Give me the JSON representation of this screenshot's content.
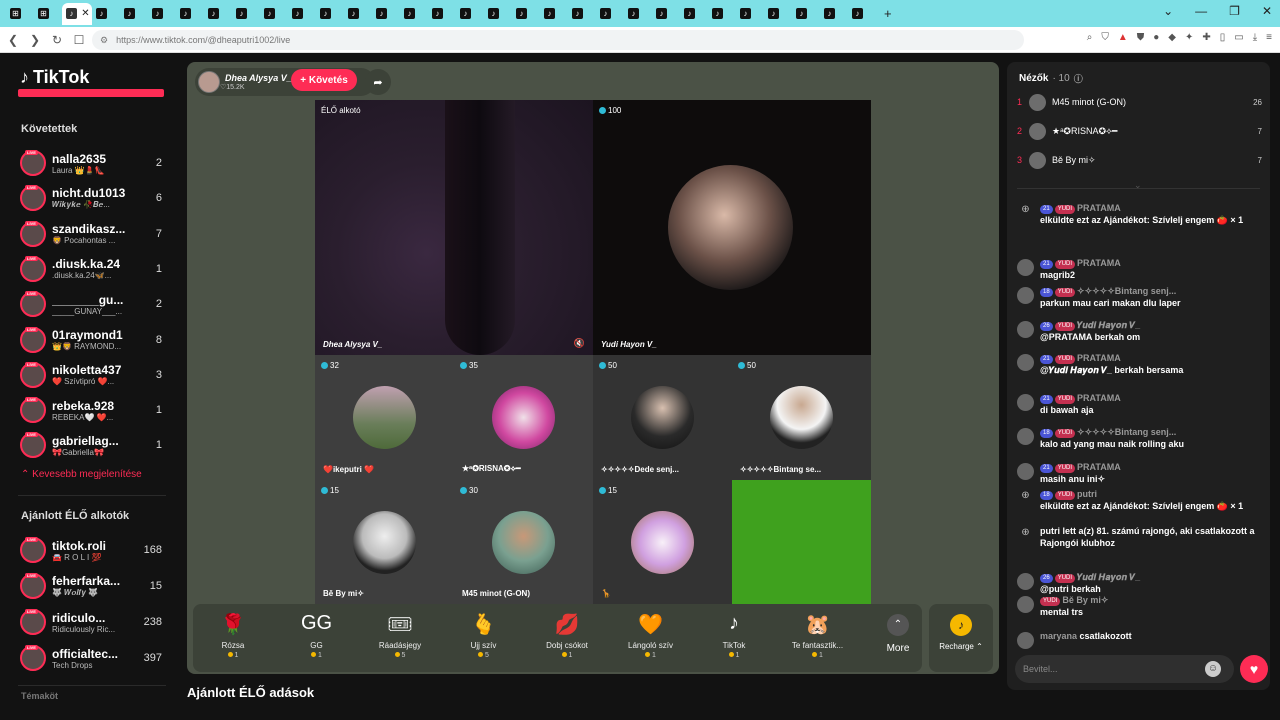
{
  "browser": {
    "tabs": [
      "",
      "",
      "",
      "",
      "",
      "",
      "",
      "",
      "",
      "",
      "",
      "",
      "",
      "",
      "",
      "",
      "",
      "",
      "",
      "",
      "",
      "",
      "",
      "",
      "",
      "",
      "",
      "",
      "",
      "",
      ""
    ],
    "active_tab_close": "✕",
    "url": "https://www.tiktok.com/@dheaputri1002/live",
    "new_tab": "+",
    "window_controls": [
      "⌄",
      "—",
      "❐",
      "✕"
    ]
  },
  "sidebar": {
    "logo": "TikTok",
    "following_title": "Követettek",
    "following": [
      {
        "name": "nalla2635",
        "sub": "Laura 👑💄👠",
        "count": "2"
      },
      {
        "name": "nicht.du1013",
        "sub": "𝑾𝒊𝒌𝒚𝒌𝒆 🥀𝑩𝒆...",
        "count": "6"
      },
      {
        "name": "szandikasz...",
        "sub": "🦁 Pocahontas ...",
        "count": "7"
      },
      {
        "name": ".diusk.ka.24",
        "sub": ".diusk.ka.24🦋...",
        "count": "1"
      },
      {
        "name": "_______gu...",
        "sub": "_____GUNAY___...",
        "count": "2"
      },
      {
        "name": "01raymond1",
        "sub": "👑🦁 RAYMOND...",
        "count": "8"
      },
      {
        "name": "nikoletta437",
        "sub": "❤️ Szívtipró ❤️...",
        "count": "3"
      },
      {
        "name": "rebeka.928",
        "sub": "REBEKA🤍 ❤️...",
        "count": "1"
      },
      {
        "name": "gabriellag...",
        "sub": "🎀Gabriella🎀",
        "count": "1"
      }
    ],
    "show_less": "Kevesebb megjelenítése",
    "recommended_title": "Ajánlott ÉLŐ alkotók",
    "recommended": [
      {
        "name": "tiktok.roli",
        "sub": "🚘 R O L I 💯",
        "count": "168"
      },
      {
        "name": "feherfarka...",
        "sub": "🐺 𝑾𝒐𝒍𝒇𝒚 🐺",
        "count": "15"
      },
      {
        "name": "ridiculo...",
        "sub": "Ridiculously Ric...",
        "count": "238"
      },
      {
        "name": "officialtec...",
        "sub": "Tech Drops",
        "count": "397"
      }
    ],
    "bottom_cut": "Témaköt"
  },
  "live": {
    "host_name": "Dhea Alysya V_",
    "host_likes": "♡15.2K",
    "follow": "+ Követés",
    "share_icon": "➦",
    "cells": [
      {
        "badge": "",
        "label": "ÉLŐ alkotó",
        "name": "Dhea Alysya V_"
      },
      {
        "badge": "100",
        "name": "Yudi Hayon V_"
      },
      {
        "badge": "32",
        "name": "❤️ikeputri ❤️"
      },
      {
        "badge": "35",
        "name": "★ᵃ✪RISNA✪⟡━"
      },
      {
        "badge": "50",
        "name": "✧✧✧✧✧Dede senj..."
      },
      {
        "badge": "50",
        "name": "✧✧✧✧✧Bintang se..."
      },
      {
        "badge": "15",
        "name": "Bě By mi✧"
      },
      {
        "badge": "30",
        "name": "M45 minot (G-ON)"
      },
      {
        "badge": "15",
        "name": "🦒"
      },
      {
        "badge": "",
        "name": ""
      }
    ]
  },
  "gifts": [
    {
      "icon": "🌹",
      "name": "Rózsa",
      "price": "1"
    },
    {
      "icon": "GG",
      "name": "GG",
      "price": "1"
    },
    {
      "icon": "🎟",
      "name": "Ráadásjegy",
      "price": "5"
    },
    {
      "icon": "🫰",
      "name": "Ujj szív",
      "price": "5"
    },
    {
      "icon": "💋",
      "name": "Dobj csókot",
      "price": "1"
    },
    {
      "icon": "🧡",
      "name": "Lángoló szív",
      "price": "1"
    },
    {
      "icon": "♪",
      "name": "TikTok",
      "price": "1"
    },
    {
      "icon": "🐹",
      "name": "Te fantasztik...",
      "price": "1"
    }
  ],
  "more": {
    "icon": "⌃",
    "label": "More"
  },
  "recharge": {
    "icon": "♪",
    "label": "Recharge ⌃"
  },
  "recommended_live_title": "Ajánlott ÉLŐ adások",
  "viewers": {
    "title": "Nézők",
    "count": "· 10",
    "list": [
      {
        "rank": "1",
        "name": "M45 minot (G-ON)",
        "count": "26"
      },
      {
        "rank": "2",
        "name": "★ᵃ✪RISNA✪⟡━",
        "count": "7"
      },
      {
        "rank": "3",
        "name": "Bě By mi✧",
        "count": "7"
      }
    ]
  },
  "chat": [
    {
      "level": "21",
      "fan": "YUDI",
      "name": "PRATAMA",
      "text": "elküldte ezt az Ajándékot: Szívlelj engem 🍅 × 1",
      "gift": true
    },
    {
      "level": "21",
      "fan": "YUDI",
      "name": "PRATAMA",
      "text": "magrib2"
    },
    {
      "level": "18",
      "fan": "YUDI",
      "name": "✧✧✧✧✧Bintang senj...",
      "text": "parkun mau cari makan dlu laper"
    },
    {
      "level": "26",
      "fan": "YUDI",
      "name": "𝒀𝒖𝒅𝒊 𝑯𝒂𝒚𝒐𝒏 𝑽_",
      "text": "@PRATAMA berkah om"
    },
    {
      "level": "21",
      "fan": "YUDI",
      "name": "PRATAMA",
      "text": "@𝒀𝒖𝒅𝒊 𝑯𝒂𝒚𝒐𝒏 𝑽_ berkah bersama"
    },
    {
      "level": "21",
      "fan": "YUDI",
      "name": "PRATAMA",
      "text": "di bawah aja"
    },
    {
      "level": "18",
      "fan": "YUDI",
      "name": "✧✧✧✧✧Bintang senj...",
      "text": "kalo ad yang mau naik rolling aku"
    },
    {
      "level": "21",
      "fan": "YUDI",
      "name": "PRATAMA",
      "text": "masih anu ini✧"
    },
    {
      "level": "18",
      "fan": "YUDI",
      "name": "putri",
      "text": "elküldte ezt az Ajándékot: Szívlelj engem 🍅 × 1",
      "gift": true
    },
    {
      "level": "",
      "fan": "",
      "name": "",
      "text": "putri lett a(z) 81. számú rajongó, aki csatlakozott a Rajongói klubhoz",
      "gift": true
    },
    {
      "level": "26",
      "fan": "YUDI",
      "name": "𝒀𝒖𝒅𝒊 𝑯𝒂𝒚𝒐𝒏 𝑽_",
      "text": "@putri berkah"
    },
    {
      "level": "",
      "fan": "YUDI",
      "name": "Bě By mi✧",
      "text": "mental trs"
    },
    {
      "level": "",
      "fan": "",
      "name": "maryana",
      "text": "csatlakozott"
    }
  ],
  "input": {
    "placeholder": "Bevitel..."
  },
  "colors": {
    "accent": "#fe2c55",
    "stage_bg": "#4b5246",
    "tab_bar": "#7ee0e6"
  }
}
